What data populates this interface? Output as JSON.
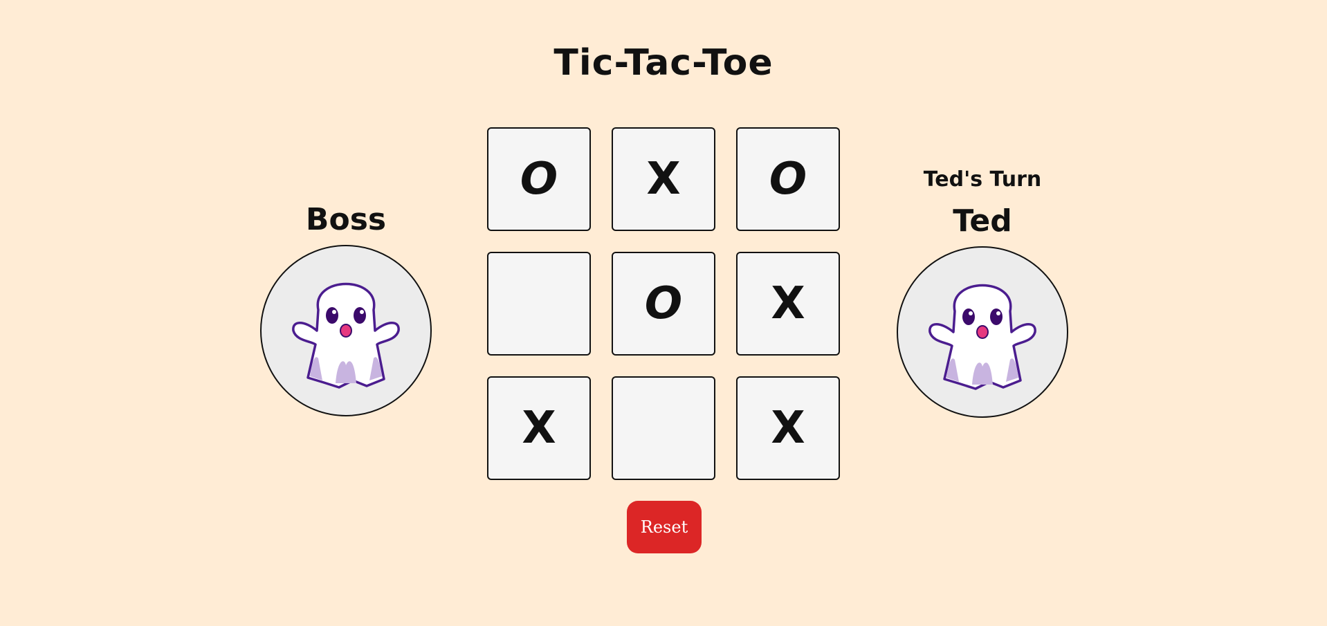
{
  "title": "Tic-Tac-Toe",
  "player_left": {
    "name": "Boss",
    "avatar_icon": "ghost-icon"
  },
  "player_right": {
    "turn_label": "Ted's Turn",
    "name": "Ted",
    "avatar_icon": "ghost-icon"
  },
  "board": {
    "cells": [
      "O",
      "X",
      "O",
      "",
      "O",
      "X",
      "X",
      "",
      "X"
    ]
  },
  "reset_label": "Reset",
  "colors": {
    "background": "#ffecd5",
    "cell": "#f5f5f5",
    "reset": "#dc2626"
  }
}
